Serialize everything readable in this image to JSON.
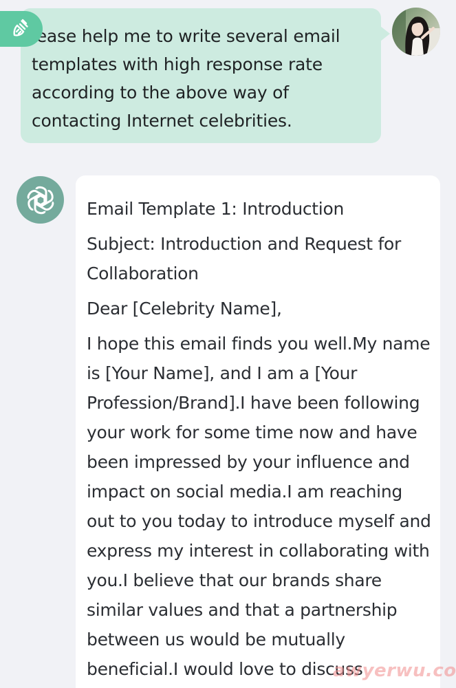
{
  "conversation": {
    "user_message": {
      "text": "lease help me to write several email templates with high response rate according to the above way of contacting Internet celebrities.",
      "avatar": "user-avatar",
      "action_icon": "broom-icon"
    },
    "assistant_message": {
      "icon": "openai-logo-icon",
      "paragraphs": [
        "Email Template 1: Introduction",
        "Subject: Introduction and Request for Collaboration",
        "Dear [Celebrity Name],",
        "I hope this email finds you well.My name is [Your Name], and I am a [Your Profession/Brand].I have been following your work for some time now and have been impressed by your influence and impact on social media.I am reaching out to you today to introduce myself and express my interest in collaborating with you.I believe that our brands share similar values and that a partnership between us would be mutually beneficial.I would love to discuss"
      ]
    }
  },
  "watermark": "awyerwu.com",
  "colors": {
    "background": "#f1f2f6",
    "user_bubble": "#cdebe0",
    "action_badge": "#5fc9a2",
    "bot_icon": "#74aa9c",
    "bot_bubble": "#ffffff",
    "text": "#2b2e33"
  }
}
